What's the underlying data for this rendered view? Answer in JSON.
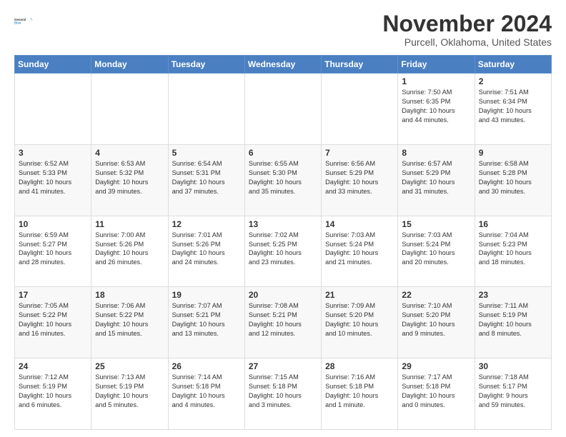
{
  "header": {
    "logo_line1": "General",
    "logo_line2": "Blue",
    "month": "November 2024",
    "location": "Purcell, Oklahoma, United States"
  },
  "weekdays": [
    "Sunday",
    "Monday",
    "Tuesday",
    "Wednesday",
    "Thursday",
    "Friday",
    "Saturday"
  ],
  "weeks": [
    [
      {
        "day": "",
        "info": ""
      },
      {
        "day": "",
        "info": ""
      },
      {
        "day": "",
        "info": ""
      },
      {
        "day": "",
        "info": ""
      },
      {
        "day": "",
        "info": ""
      },
      {
        "day": "1",
        "info": "Sunrise: 7:50 AM\nSunset: 6:35 PM\nDaylight: 10 hours\nand 44 minutes."
      },
      {
        "day": "2",
        "info": "Sunrise: 7:51 AM\nSunset: 6:34 PM\nDaylight: 10 hours\nand 43 minutes."
      }
    ],
    [
      {
        "day": "3",
        "info": "Sunrise: 6:52 AM\nSunset: 5:33 PM\nDaylight: 10 hours\nand 41 minutes."
      },
      {
        "day": "4",
        "info": "Sunrise: 6:53 AM\nSunset: 5:32 PM\nDaylight: 10 hours\nand 39 minutes."
      },
      {
        "day": "5",
        "info": "Sunrise: 6:54 AM\nSunset: 5:31 PM\nDaylight: 10 hours\nand 37 minutes."
      },
      {
        "day": "6",
        "info": "Sunrise: 6:55 AM\nSunset: 5:30 PM\nDaylight: 10 hours\nand 35 minutes."
      },
      {
        "day": "7",
        "info": "Sunrise: 6:56 AM\nSunset: 5:29 PM\nDaylight: 10 hours\nand 33 minutes."
      },
      {
        "day": "8",
        "info": "Sunrise: 6:57 AM\nSunset: 5:29 PM\nDaylight: 10 hours\nand 31 minutes."
      },
      {
        "day": "9",
        "info": "Sunrise: 6:58 AM\nSunset: 5:28 PM\nDaylight: 10 hours\nand 30 minutes."
      }
    ],
    [
      {
        "day": "10",
        "info": "Sunrise: 6:59 AM\nSunset: 5:27 PM\nDaylight: 10 hours\nand 28 minutes."
      },
      {
        "day": "11",
        "info": "Sunrise: 7:00 AM\nSunset: 5:26 PM\nDaylight: 10 hours\nand 26 minutes."
      },
      {
        "day": "12",
        "info": "Sunrise: 7:01 AM\nSunset: 5:26 PM\nDaylight: 10 hours\nand 24 minutes."
      },
      {
        "day": "13",
        "info": "Sunrise: 7:02 AM\nSunset: 5:25 PM\nDaylight: 10 hours\nand 23 minutes."
      },
      {
        "day": "14",
        "info": "Sunrise: 7:03 AM\nSunset: 5:24 PM\nDaylight: 10 hours\nand 21 minutes."
      },
      {
        "day": "15",
        "info": "Sunrise: 7:03 AM\nSunset: 5:24 PM\nDaylight: 10 hours\nand 20 minutes."
      },
      {
        "day": "16",
        "info": "Sunrise: 7:04 AM\nSunset: 5:23 PM\nDaylight: 10 hours\nand 18 minutes."
      }
    ],
    [
      {
        "day": "17",
        "info": "Sunrise: 7:05 AM\nSunset: 5:22 PM\nDaylight: 10 hours\nand 16 minutes."
      },
      {
        "day": "18",
        "info": "Sunrise: 7:06 AM\nSunset: 5:22 PM\nDaylight: 10 hours\nand 15 minutes."
      },
      {
        "day": "19",
        "info": "Sunrise: 7:07 AM\nSunset: 5:21 PM\nDaylight: 10 hours\nand 13 minutes."
      },
      {
        "day": "20",
        "info": "Sunrise: 7:08 AM\nSunset: 5:21 PM\nDaylight: 10 hours\nand 12 minutes."
      },
      {
        "day": "21",
        "info": "Sunrise: 7:09 AM\nSunset: 5:20 PM\nDaylight: 10 hours\nand 10 minutes."
      },
      {
        "day": "22",
        "info": "Sunrise: 7:10 AM\nSunset: 5:20 PM\nDaylight: 10 hours\nand 9 minutes."
      },
      {
        "day": "23",
        "info": "Sunrise: 7:11 AM\nSunset: 5:19 PM\nDaylight: 10 hours\nand 8 minutes."
      }
    ],
    [
      {
        "day": "24",
        "info": "Sunrise: 7:12 AM\nSunset: 5:19 PM\nDaylight: 10 hours\nand 6 minutes."
      },
      {
        "day": "25",
        "info": "Sunrise: 7:13 AM\nSunset: 5:19 PM\nDaylight: 10 hours\nand 5 minutes."
      },
      {
        "day": "26",
        "info": "Sunrise: 7:14 AM\nSunset: 5:18 PM\nDaylight: 10 hours\nand 4 minutes."
      },
      {
        "day": "27",
        "info": "Sunrise: 7:15 AM\nSunset: 5:18 PM\nDaylight: 10 hours\nand 3 minutes."
      },
      {
        "day": "28",
        "info": "Sunrise: 7:16 AM\nSunset: 5:18 PM\nDaylight: 10 hours\nand 1 minute."
      },
      {
        "day": "29",
        "info": "Sunrise: 7:17 AM\nSunset: 5:18 PM\nDaylight: 10 hours\nand 0 minutes."
      },
      {
        "day": "30",
        "info": "Sunrise: 7:18 AM\nSunset: 5:17 PM\nDaylight: 9 hours\nand 59 minutes."
      }
    ]
  ]
}
